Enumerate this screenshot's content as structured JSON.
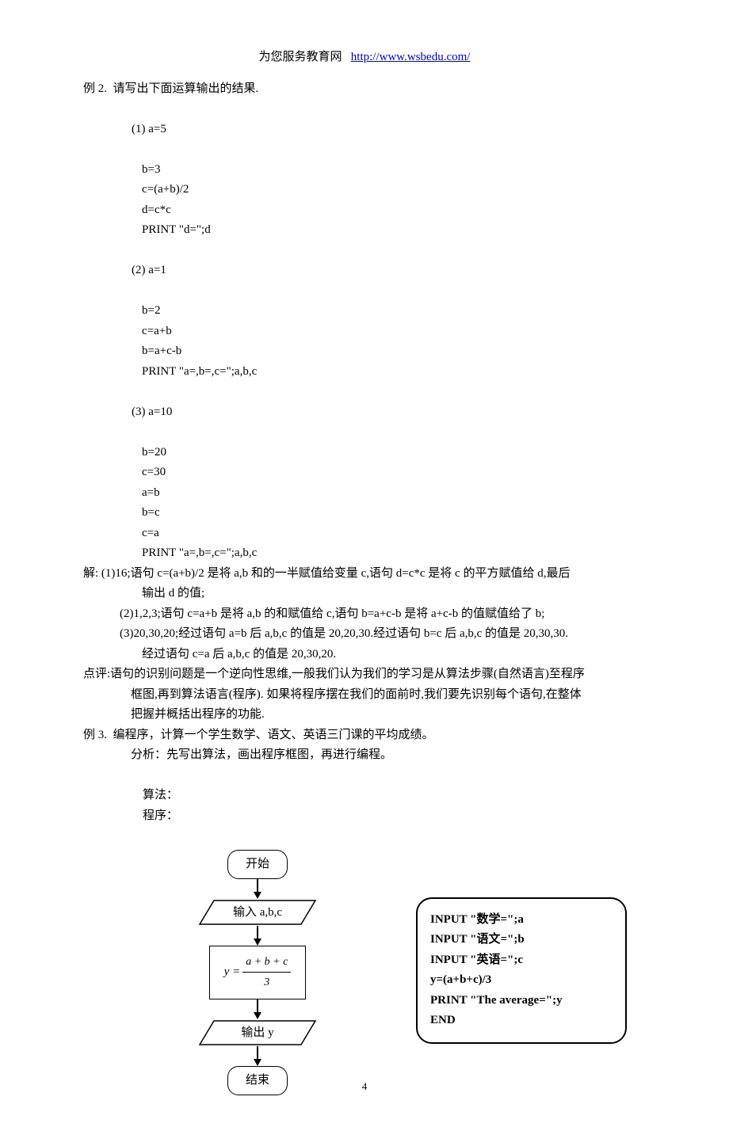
{
  "header": {
    "site_name": "为您服务教育网",
    "url_text": "http://www.wsbedu.com/"
  },
  "example2": {
    "title": "例 2.  请写出下面运算输出的结果.",
    "sub1": {
      "label": "(1)",
      "l1": "a=5",
      "l2": "b=3",
      "l3": "c=(a+b)/2",
      "l4": "d=c*c",
      "l5": "PRINT \"d=\";d"
    },
    "sub2": {
      "label": "(2)",
      "l1": "a=1",
      "l2": "b=2",
      "l3": "c=a+b",
      "l4": "b=a+c-b",
      "l5": "PRINT \"a=,b=,c=\";a,b,c"
    },
    "sub3": {
      "label": "(3)",
      "l1": "a=10",
      "l2": "b=20",
      "l3": "c=30",
      "l4": "a=b",
      "l5": "b=c",
      "l6": "c=a",
      "l7": "PRINT \"a=,b=,c=\";a,b,c"
    }
  },
  "solution": {
    "s1a": "解: (1)16;语句 c=(a+b)/2 是将 a,b 和的一半赋值给变量 c,语句 d=c*c 是将 c 的平方赋值给 d,最后",
    "s1b": "输出 d 的值;",
    "s2": "(2)1,2,3;语句 c=a+b 是将 a,b 的和赋值给 c,语句 b=a+c-b 是将 a+c-b 的值赋值给了 b;",
    "s3a": "(3)20,30,20;经过语句 a=b 后 a,b,c 的值是 20,20,30.经过语句 b=c 后 a,b,c 的值是 20,30,30.",
    "s3b": "经过语句 c=a 后 a,b,c 的值是 20,30,20."
  },
  "comment": {
    "l1": "点评:语句的识别问题是一个逆向性思维,一般我们认为我们的学习是从算法步骤(自然语言)至程序",
    "l2": "框图,再到算法语言(程序). 如果将程序摆在我们的面前时,我们要先识别每个语句,在整体",
    "l3": "把握并概括出程序的功能."
  },
  "example3": {
    "title": "例 3.  编程序，计算一个学生数学、语文、英语三门课的平均成绩。",
    "analysis": "分析：先写出算法，画出程序框图，再进行编程。",
    "algo_label": "算法：",
    "prog_label": "程序：",
    "flowchart": {
      "start": "开始",
      "input": "输入 a,b,c",
      "y_prefix": "y =",
      "num": "a + b + c",
      "den": "3",
      "output": "输出 y",
      "end": "结束"
    },
    "program": {
      "l1": "INPUT  \"数学=\";a",
      "l2": "INPUT  \"语文=\";b",
      "l3": "INPUT  \"英语=\";c",
      "l4": " y=(a+b+c)/3",
      "l5": "PRINT  \"The average=\";y",
      "l6": "END"
    }
  },
  "page_number": "4"
}
